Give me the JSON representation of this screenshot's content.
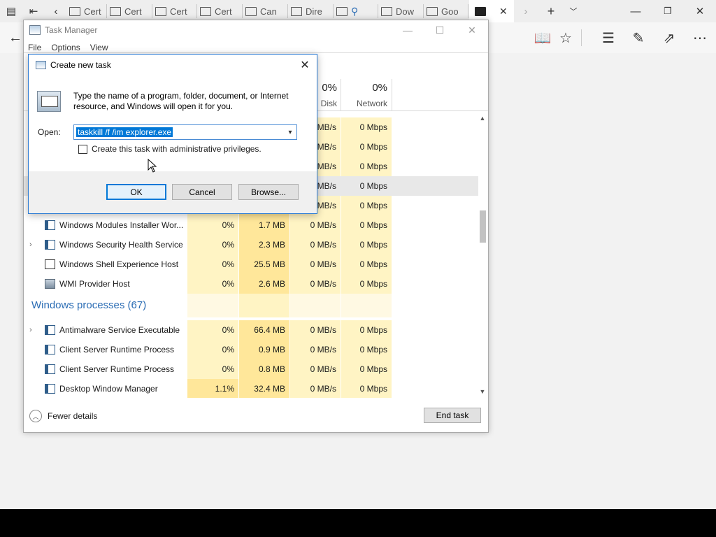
{
  "browser": {
    "tabs": [
      {
        "label": "Cert"
      },
      {
        "label": "Cert"
      },
      {
        "label": "Cert"
      },
      {
        "label": "Cert"
      },
      {
        "label": "Can"
      },
      {
        "label": "Dire"
      },
      {
        "label": ""
      },
      {
        "label": "Dow"
      },
      {
        "label": "Goo"
      }
    ]
  },
  "task_manager": {
    "title": "Task Manager",
    "menu": [
      "File",
      "Options",
      "View"
    ],
    "columns": {
      "disk": {
        "pct": "0%",
        "name": "Disk"
      },
      "network": {
        "pct": "0%",
        "name": "Network"
      }
    },
    "rows_partial": [
      {
        "disk": "MB/s",
        "network": "0 Mbps"
      },
      {
        "disk": "MB/s",
        "network": "0 Mbps"
      },
      {
        "disk": "MB/s",
        "network": "0 Mbps"
      },
      {
        "disk": "MB/s",
        "network": "0 Mbps"
      },
      {
        "disk": "MB/s",
        "network": "0 Mbps"
      }
    ],
    "rows": [
      {
        "name": "Windows Modules Installer Wor...",
        "cpu": "0%",
        "memory": "1.7 MB",
        "disk": "0 MB/s",
        "network": "0 Mbps",
        "expandable": false
      },
      {
        "name": "Windows Security Health Service",
        "cpu": "0%",
        "memory": "2.3 MB",
        "disk": "0 MB/s",
        "network": "0 Mbps",
        "expandable": true
      },
      {
        "name": "Windows Shell Experience Host",
        "cpu": "0%",
        "memory": "25.5 MB",
        "disk": "0 MB/s",
        "network": "0 Mbps",
        "expandable": false
      },
      {
        "name": "WMI Provider Host",
        "cpu": "0%",
        "memory": "2.6 MB",
        "disk": "0 MB/s",
        "network": "0 Mbps",
        "expandable": false
      }
    ],
    "group_title": "Windows processes (67)",
    "group_rows": [
      {
        "name": "Antimalware Service Executable",
        "cpu": "0%",
        "memory": "66.4 MB",
        "disk": "0 MB/s",
        "network": "0 Mbps",
        "expandable": true
      },
      {
        "name": "Client Server Runtime Process",
        "cpu": "0%",
        "memory": "0.9 MB",
        "disk": "0 MB/s",
        "network": "0 Mbps",
        "expandable": false
      },
      {
        "name": "Client Server Runtime Process",
        "cpu": "0%",
        "memory": "0.8 MB",
        "disk": "0 MB/s",
        "network": "0 Mbps",
        "expandable": false
      },
      {
        "name": "Desktop Window Manager",
        "cpu": "1.1%",
        "memory": "32.4 MB",
        "disk": "0 MB/s",
        "network": "0 Mbps",
        "expandable": false
      }
    ],
    "footer": {
      "fewer_details": "Fewer details",
      "end_task": "End task"
    }
  },
  "dialog": {
    "title": "Create new task",
    "description": "Type the name of a program, folder, document, or Internet resource, and Windows will open it for you.",
    "open_label": "Open:",
    "open_value": "taskkill /f /im explorer.exe",
    "admin_checkbox_label": "Create this task with administrative privileges.",
    "admin_checked": false,
    "buttons": {
      "ok": "OK",
      "cancel": "Cancel",
      "browse": "Browse..."
    }
  }
}
